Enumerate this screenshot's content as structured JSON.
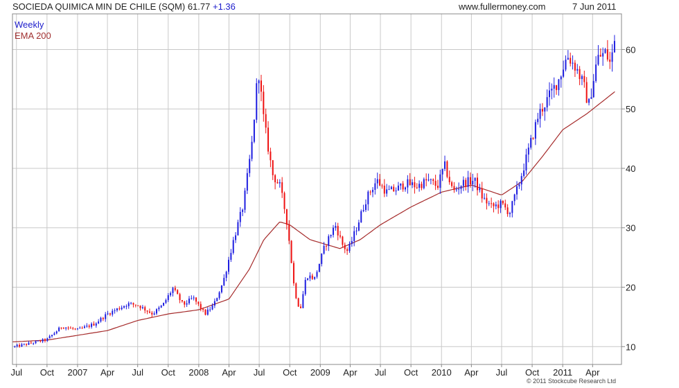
{
  "header": {
    "title": "SOCIEDA QUIMICA MIN DE CHILE (SQM)",
    "price": "61.77",
    "change": "+1.36",
    "site": "www.fullermoney.com",
    "date": "7 Jun 2011"
  },
  "copyright": "© 2011 Stockcube Research Ltd",
  "colors": {
    "up": "#1e1ee0",
    "down": "#ee1111",
    "ema": "#a52a2a",
    "grid": "#c8c8c8"
  },
  "chart_data": {
    "type": "candlestick",
    "legend": [
      {
        "label": "Weekly",
        "color": "#2020cc"
      },
      {
        "label": "EMA 200",
        "color": "#a03030"
      }
    ],
    "legend_position": "top-left",
    "grid": true,
    "y_axis_position": "right",
    "ylim": [
      7,
      66
    ],
    "yticks": [
      10,
      20,
      30,
      40,
      50,
      60
    ],
    "xlim": [
      "2006-06-19",
      "2011-06-27"
    ],
    "xticks": [
      {
        "label": "Jul",
        "date": "2006-07-01"
      },
      {
        "label": "Oct",
        "date": "2006-10-01"
      },
      {
        "label": "2007",
        "date": "2007-01-01"
      },
      {
        "label": "Apr",
        "date": "2007-04-01"
      },
      {
        "label": "Jul",
        "date": "2007-07-01"
      },
      {
        "label": "Oct",
        "date": "2007-10-01"
      },
      {
        "label": "2008",
        "date": "2008-01-01"
      },
      {
        "label": "Apr",
        "date": "2008-04-01"
      },
      {
        "label": "Jul",
        "date": "2008-07-01"
      },
      {
        "label": "Oct",
        "date": "2008-10-01"
      },
      {
        "label": "2009",
        "date": "2009-01-01"
      },
      {
        "label": "Apr",
        "date": "2009-04-01"
      },
      {
        "label": "Jul",
        "date": "2009-07-01"
      },
      {
        "label": "Oct",
        "date": "2009-10-01"
      },
      {
        "label": "2010",
        "date": "2010-01-01"
      },
      {
        "label": "Apr",
        "date": "2010-04-01"
      },
      {
        "label": "Jul",
        "date": "2010-07-01"
      },
      {
        "label": "Oct",
        "date": "2010-10-01"
      },
      {
        "label": "2011",
        "date": "2011-01-01"
      },
      {
        "label": "Apr",
        "date": "2011-04-01"
      }
    ],
    "price_anchors": [
      [
        "2006-06-26",
        10.0
      ],
      [
        "2006-08-15",
        10.6
      ],
      [
        "2006-10-01",
        11.2
      ],
      [
        "2006-11-15",
        13.4
      ],
      [
        "2007-01-01",
        12.8
      ],
      [
        "2007-02-20",
        13.8
      ],
      [
        "2007-04-01",
        15.5
      ],
      [
        "2007-06-01",
        17.2
      ],
      [
        "2007-07-01",
        17.0
      ],
      [
        "2007-08-15",
        15.5
      ],
      [
        "2007-09-15",
        17.0
      ],
      [
        "2007-10-15",
        19.8
      ],
      [
        "2007-11-15",
        17.0
      ],
      [
        "2007-12-15",
        18.2
      ],
      [
        "2008-01-20",
        15.5
      ],
      [
        "2008-02-15",
        17.0
      ],
      [
        "2008-03-15",
        21.0
      ],
      [
        "2008-04-15",
        28.0
      ],
      [
        "2008-05-15",
        34.0
      ],
      [
        "2008-06-10",
        44.5
      ],
      [
        "2008-06-28",
        57.0
      ],
      [
        "2008-07-15",
        48.0
      ],
      [
        "2008-08-10",
        39.0
      ],
      [
        "2008-09-01",
        37.0
      ],
      [
        "2008-09-20",
        32.0
      ],
      [
        "2008-10-01",
        27.0
      ],
      [
        "2008-10-15",
        19.5
      ],
      [
        "2008-11-01",
        16.0
      ],
      [
        "2008-11-20",
        22.0
      ],
      [
        "2008-12-15",
        21.5
      ],
      [
        "2009-01-15",
        27.0
      ],
      [
        "2009-02-15",
        30.5
      ],
      [
        "2009-03-10",
        27.0
      ],
      [
        "2009-03-25",
        26.0
      ],
      [
        "2009-04-20",
        30.0
      ],
      [
        "2009-05-20",
        35.0
      ],
      [
        "2009-06-20",
        38.0
      ],
      [
        "2009-07-20",
        36.0
      ],
      [
        "2009-08-20",
        36.5
      ],
      [
        "2009-09-15",
        37.5
      ],
      [
        "2009-10-20",
        37.0
      ],
      [
        "2009-11-20",
        38.0
      ],
      [
        "2009-12-20",
        37.0
      ],
      [
        "2010-01-10",
        40.5
      ],
      [
        "2010-02-05",
        36.0
      ],
      [
        "2010-03-05",
        37.5
      ],
      [
        "2010-04-10",
        38.0
      ],
      [
        "2010-05-05",
        35.0
      ],
      [
        "2010-06-01",
        33.5
      ],
      [
        "2010-07-01",
        34.0
      ],
      [
        "2010-07-25",
        32.5
      ],
      [
        "2010-08-20",
        37.0
      ],
      [
        "2010-09-20",
        43.0
      ],
      [
        "2010-10-20",
        49.0
      ],
      [
        "2010-11-20",
        52.0
      ],
      [
        "2010-12-20",
        55.0
      ],
      [
        "2011-01-15",
        59.0
      ],
      [
        "2011-02-10",
        57.0
      ],
      [
        "2011-03-05",
        54.0
      ],
      [
        "2011-03-20",
        50.5
      ],
      [
        "2011-04-15",
        58.5
      ],
      [
        "2011-05-10",
        59.5
      ],
      [
        "2011-05-25",
        57.5
      ],
      [
        "2011-06-07",
        61.77
      ]
    ],
    "ema_200": [
      [
        "2006-06-19",
        10.8
      ],
      [
        "2006-10-01",
        11.1
      ],
      [
        "2007-01-01",
        11.9
      ],
      [
        "2007-04-01",
        12.7
      ],
      [
        "2007-07-01",
        14.4
      ],
      [
        "2007-10-01",
        15.5
      ],
      [
        "2008-01-01",
        16.2
      ],
      [
        "2008-04-01",
        18.0
      ],
      [
        "2008-06-01",
        23.0
      ],
      [
        "2008-07-15",
        28.0
      ],
      [
        "2008-09-01",
        31.0
      ],
      [
        "2008-10-01",
        30.5
      ],
      [
        "2008-12-01",
        28.0
      ],
      [
        "2009-03-01",
        26.5
      ],
      [
        "2009-05-01",
        28.0
      ],
      [
        "2009-07-01",
        30.5
      ],
      [
        "2009-10-01",
        33.5
      ],
      [
        "2010-01-01",
        36.0
      ],
      [
        "2010-04-01",
        37.2
      ],
      [
        "2010-07-01",
        35.5
      ],
      [
        "2010-09-01",
        37.8
      ],
      [
        "2010-11-01",
        42.0
      ],
      [
        "2011-01-01",
        46.5
      ],
      [
        "2011-03-15",
        49.2
      ],
      [
        "2011-06-07",
        52.9
      ]
    ]
  }
}
